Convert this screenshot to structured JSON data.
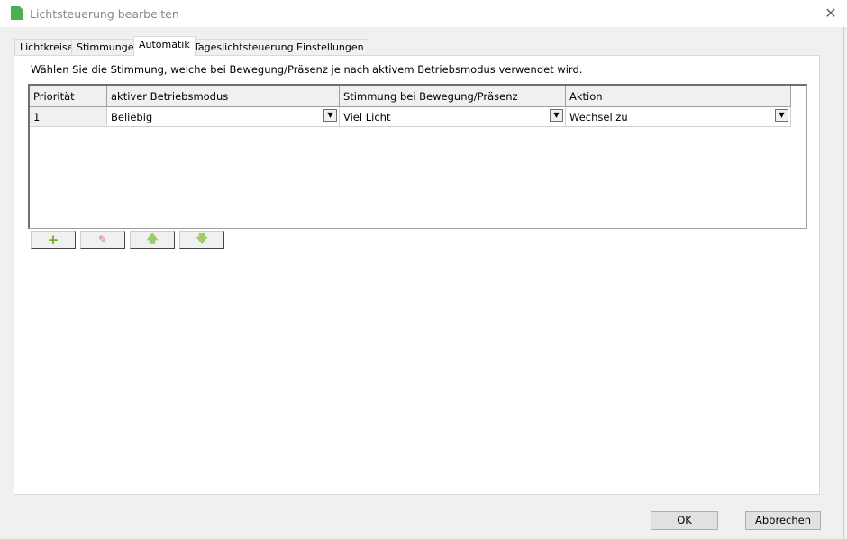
{
  "window": {
    "title": "Lichtsteuerung bearbeiten"
  },
  "tabs": [
    {
      "label": "Lichtkreise"
    },
    {
      "label": "Stimmungen"
    },
    {
      "label": "Automatik"
    },
    {
      "label": "Tageslichtsteuerung Einstellungen"
    }
  ],
  "description": "Wählen Sie die Stimmung, welche bei Bewegung/Präsenz je nach aktivem Betriebsmodus verwendet wird.",
  "table": {
    "columns": [
      "Priorität",
      "aktiver Betriebsmodus",
      "Stimmung bei Bewegung/Präsenz",
      "Aktion"
    ],
    "rows": [
      {
        "priority": "1",
        "mode": "Beliebig",
        "scene": "Viel Licht",
        "action": "Wechsel zu"
      }
    ]
  },
  "toolbar": {
    "add": "+",
    "remove": "✎",
    "up": "🡅",
    "down": "🡇"
  },
  "buttons": {
    "ok": "OK",
    "cancel": "Abbrechen"
  }
}
